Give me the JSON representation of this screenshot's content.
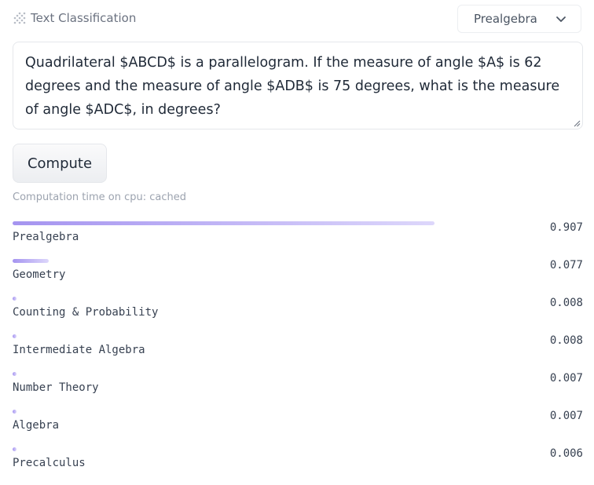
{
  "header": {
    "icon": "label-icon",
    "title": "Text Classification"
  },
  "model_select": {
    "value": "Prealgebra",
    "icon": "chevron-down-icon"
  },
  "input": {
    "value": "Quadrilateral $ABCD$ is a parallelogram. If the measure of angle $A$ is 62 degrees and the measure of angle $ADB$ is 75 degrees, what is the measure of angle $ADC$, in degrees?"
  },
  "compute_button": {
    "label": "Compute"
  },
  "computation_time": "Computation time on cpu: cached",
  "results": [
    {
      "label": "Prealgebra",
      "score": "0.907",
      "fraction": 0.907
    },
    {
      "label": "Geometry",
      "score": "0.077",
      "fraction": 0.077
    },
    {
      "label": "Counting & Probability",
      "score": "0.008",
      "fraction": 0.008
    },
    {
      "label": "Intermediate Algebra",
      "score": "0.008",
      "fraction": 0.008
    },
    {
      "label": "Number Theory",
      "score": "0.007",
      "fraction": 0.007
    },
    {
      "label": "Algebra",
      "score": "0.007",
      "fraction": 0.007
    },
    {
      "label": "Precalculus",
      "score": "0.006",
      "fraction": 0.006
    }
  ],
  "colors": {
    "bar_start": "#a594f0",
    "bar_end": "#ddd7fb"
  }
}
